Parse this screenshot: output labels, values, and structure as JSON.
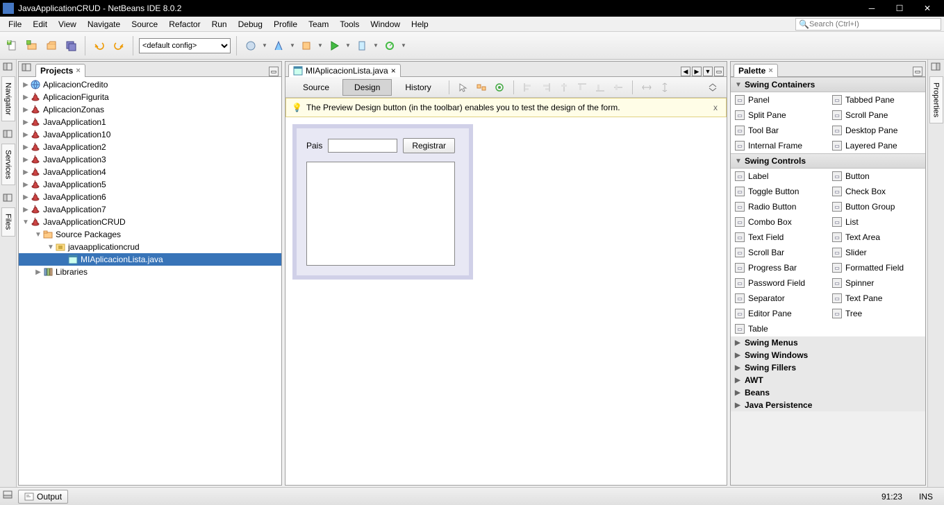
{
  "window": {
    "title": "JavaApplicationCRUD - NetBeans IDE 8.0.2"
  },
  "menu": [
    "File",
    "Edit",
    "View",
    "Navigate",
    "Source",
    "Refactor",
    "Run",
    "Debug",
    "Profile",
    "Team",
    "Tools",
    "Window",
    "Help"
  ],
  "search": {
    "placeholder": "Search (Ctrl+I)"
  },
  "config": {
    "selected": "<default config>"
  },
  "side_left": [
    "Navigator",
    "Services",
    "Files"
  ],
  "side_right": [
    "Properties"
  ],
  "projects": {
    "tab": "Projects",
    "items": [
      {
        "d": 0,
        "tw": "▶",
        "icon": "globe",
        "label": "AplicacionCredito"
      },
      {
        "d": 0,
        "tw": "▶",
        "icon": "java",
        "label": "AplicacionFigurita"
      },
      {
        "d": 0,
        "tw": "▶",
        "icon": "java",
        "label": "AplicacionZonas"
      },
      {
        "d": 0,
        "tw": "▶",
        "icon": "java",
        "label": "JavaApplication1"
      },
      {
        "d": 0,
        "tw": "▶",
        "icon": "java",
        "label": "JavaApplication10"
      },
      {
        "d": 0,
        "tw": "▶",
        "icon": "java",
        "label": "JavaApplication2"
      },
      {
        "d": 0,
        "tw": "▶",
        "icon": "java",
        "label": "JavaApplication3"
      },
      {
        "d": 0,
        "tw": "▶",
        "icon": "java",
        "label": "JavaApplication4"
      },
      {
        "d": 0,
        "tw": "▶",
        "icon": "java",
        "label": "JavaApplication5"
      },
      {
        "d": 0,
        "tw": "▶",
        "icon": "java",
        "label": "JavaApplication6"
      },
      {
        "d": 0,
        "tw": "▶",
        "icon": "java",
        "label": "JavaApplication7"
      },
      {
        "d": 0,
        "tw": "▼",
        "icon": "java",
        "label": "JavaApplicationCRUD"
      },
      {
        "d": 1,
        "tw": "▼",
        "icon": "pkg",
        "label": "Source Packages"
      },
      {
        "d": 2,
        "tw": "▼",
        "icon": "pkg2",
        "label": "javaapplicationcrud"
      },
      {
        "d": 3,
        "tw": "",
        "icon": "form",
        "label": "MIAplicacionLista.java",
        "sel": true
      },
      {
        "d": 1,
        "tw": "▶",
        "icon": "lib",
        "label": "Libraries"
      }
    ]
  },
  "editor": {
    "tab": "MIAplicacionLista.java",
    "views": {
      "source": "Source",
      "design": "Design",
      "history": "History"
    },
    "hint": "The Preview Design button (in the toolbar) enables you to test the design of the form.",
    "form": {
      "label_pais": "Pais",
      "btn_registrar": "Registrar"
    }
  },
  "palette": {
    "tab": "Palette",
    "cat_containers": "Swing Containers",
    "containers": [
      "Panel",
      "Tabbed Pane",
      "Split Pane",
      "Scroll Pane",
      "Tool Bar",
      "Desktop Pane",
      "Internal Frame",
      "Layered Pane"
    ],
    "cat_controls": "Swing Controls",
    "controls": [
      "Label",
      "Button",
      "Toggle Button",
      "Check Box",
      "Radio Button",
      "Button Group",
      "Combo Box",
      "List",
      "Text Field",
      "Text Area",
      "Scroll Bar",
      "Slider",
      "Progress Bar",
      "Formatted Field",
      "Password Field",
      "Spinner",
      "Separator",
      "Text Pane",
      "Editor Pane",
      "Tree",
      "Table"
    ],
    "collapsed": [
      "Swing Menus",
      "Swing Windows",
      "Swing Fillers",
      "AWT",
      "Beans",
      "Java Persistence"
    ]
  },
  "status": {
    "output": "Output",
    "pos": "91:23",
    "ins": "INS"
  }
}
